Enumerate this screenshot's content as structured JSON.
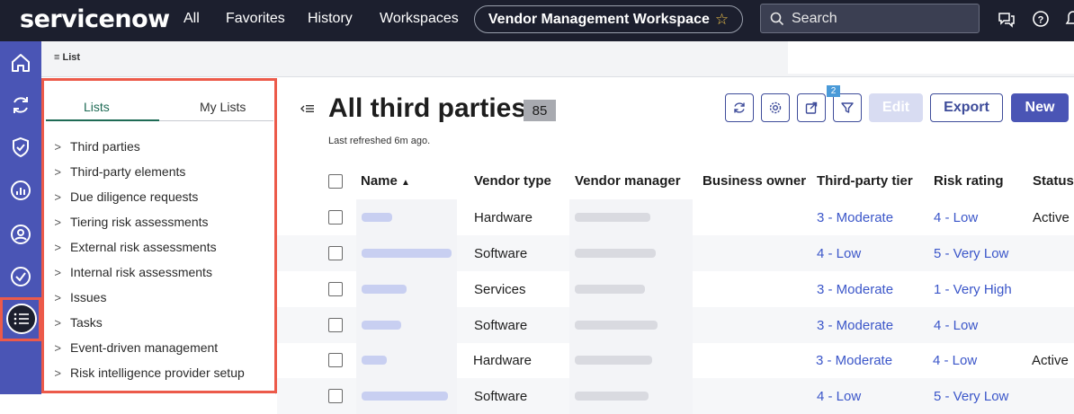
{
  "topnav": {
    "logo": "servicenow",
    "links": [
      "All",
      "Favorites",
      "History",
      "Workspaces"
    ],
    "workspace": "Vendor Management Workspace",
    "search_placeholder": "Search"
  },
  "subheader": {
    "tab_label": "List"
  },
  "lists_panel": {
    "tabs": [
      "Lists",
      "My Lists"
    ],
    "active_tab": "Lists",
    "items": [
      "Third parties",
      "Third-party elements",
      "Due diligence requests",
      "Tiering risk assessments",
      "External risk assessments",
      "Internal risk assessments",
      "Issues",
      "Tasks",
      "Event-driven management",
      "Risk intelligence provider setup"
    ]
  },
  "main": {
    "title": "All third parties",
    "count": "85",
    "last_refreshed": "Last refreshed 6m ago.",
    "filter_badge": "2",
    "buttons": {
      "edit": "Edit",
      "export": "Export",
      "new": "New"
    },
    "columns": [
      "Name",
      "Vendor type",
      "Vendor manager",
      "Business owner",
      "Third-party tier",
      "Risk rating",
      "Status"
    ],
    "sort": {
      "column": "Name",
      "direction": "ascending"
    },
    "rows": [
      {
        "vendor_type": "Hardware",
        "tier": "3 - Moderate",
        "risk": "4 - Low",
        "status": "Active"
      },
      {
        "vendor_type": "Software",
        "tier": "4 - Low",
        "risk": "5 - Very Low",
        "status": ""
      },
      {
        "vendor_type": "Services",
        "tier": "3 - Moderate",
        "risk": "1 - Very High",
        "status": ""
      },
      {
        "vendor_type": "Software",
        "tier": "3 - Moderate",
        "risk": "4 - Low",
        "status": ""
      },
      {
        "vendor_type": "Hardware",
        "tier": "3 - Moderate",
        "risk": "4 - Low",
        "status": "Active"
      },
      {
        "vendor_type": "Software",
        "tier": "4 - Low",
        "risk": "5 - Very Low",
        "status": ""
      }
    ]
  },
  "colors": {
    "nav_bg": "#1c1f2e",
    "rail_bg": "#4a55b5",
    "accent": "#3e4c9a",
    "link": "#3b56c9",
    "highlight": "#ec5a4a",
    "tab_active": "#1e6b55"
  }
}
